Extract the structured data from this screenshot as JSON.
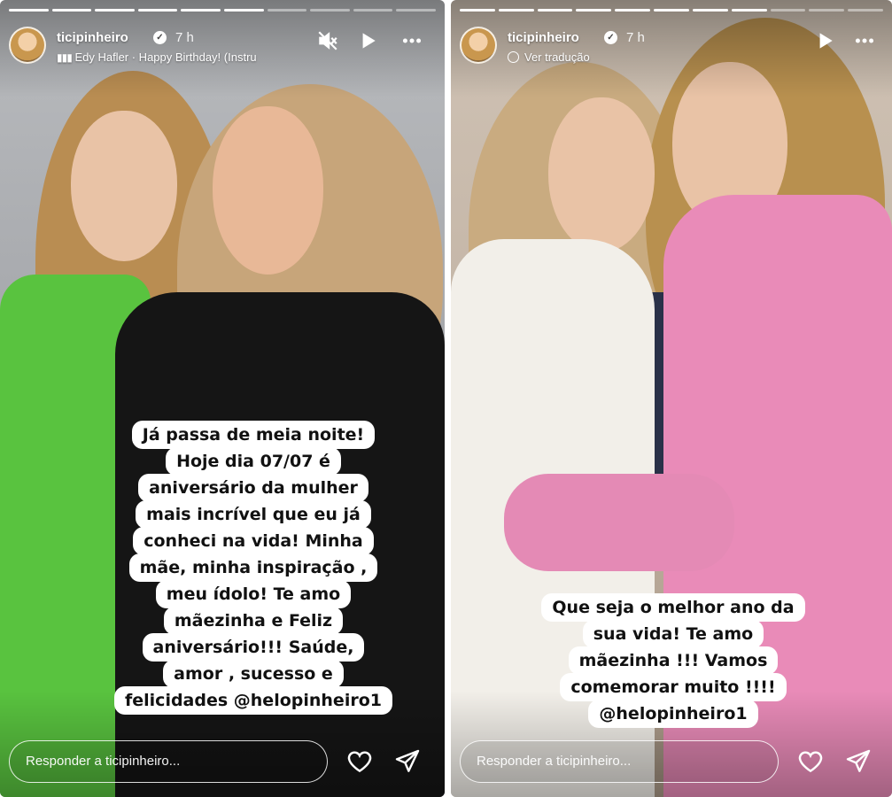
{
  "stories": [
    {
      "username": "ticipinheiro",
      "time": "7 h",
      "music": "Edy Hafler · Happy Birthday! (Instru",
      "caption": [
        "Já passa de meia noite!",
        "Hoje dia 07/07 é",
        "aniversário da mulher",
        "mais incrível que eu já",
        "conheci na vida! Minha",
        "mãe, minha inspiração ,",
        "meu ídolo! Te amo",
        "mãezinha e Feliz",
        "aniversário!!! Saúde,",
        "amor , sucesso e",
        "felicidades @helopinheiro1"
      ],
      "reply_placeholder": "Responder a ticipinheiro...",
      "icons": {
        "mute": "speaker-muted-icon",
        "play": "play-icon",
        "more": "more-icon",
        "like": "heart-icon",
        "share": "send-icon"
      }
    },
    {
      "username": "ticipinheiro",
      "time": "7 h",
      "translate": "Ver tradução",
      "caption": [
        "Que seja o melhor ano da",
        "sua vida! Te amo",
        "mãezinha !!! Vamos",
        "comemorar muito !!!!",
        "@helopinheiro1"
      ],
      "reply_placeholder": "Responder a ticipinheiro...",
      "icons": {
        "play": "play-icon",
        "more": "more-icon",
        "like": "heart-icon",
        "share": "send-icon"
      }
    }
  ],
  "colors": {
    "green_blazer": "#59c33f",
    "pink_blazer": "#e98bb8",
    "white_blazer": "#f2efe9",
    "black_top": "#151515"
  }
}
